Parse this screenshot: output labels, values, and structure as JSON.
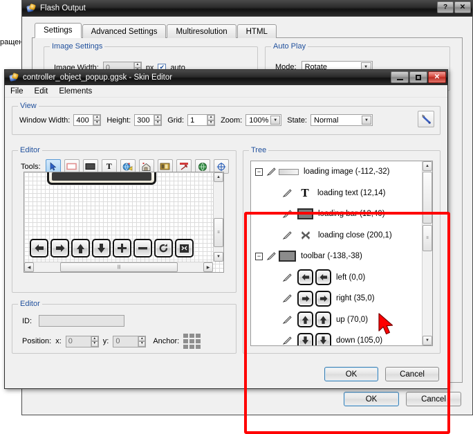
{
  "desktop": {
    "background_text": "ращени"
  },
  "flash_window": {
    "title": "Flash Output",
    "icon": "flash-app-icon",
    "help_button": "?",
    "close_button": "✕",
    "tabs": [
      {
        "label": "Settings",
        "active": true
      },
      {
        "label": "Advanced Settings",
        "active": false
      },
      {
        "label": "Multiresolution",
        "active": false
      },
      {
        "label": "HTML",
        "active": false
      }
    ],
    "image_settings": {
      "legend": "Image Settings",
      "width_label": "Image Width:",
      "width_value": "0",
      "unit_label": "px",
      "auto_checkbox": {
        "label": "auto",
        "checked": true
      }
    },
    "auto_play": {
      "legend": "Auto Play",
      "mode_label": "Mode:",
      "mode_value": "Rotate"
    },
    "ok_label": "OK",
    "cancel_label": "Cancel"
  },
  "skin_window": {
    "title": "controller_object_popup.ggsk - Skin Editor",
    "icon": "skin-editor-app-icon",
    "minimize_button": "—",
    "maximize_button": "❐",
    "close_button": "✕",
    "menu": [
      "File",
      "Edit",
      "Elements"
    ],
    "view": {
      "legend": "View",
      "window_width_label": "Window Width:",
      "window_width_value": "400",
      "height_label": "Height:",
      "height_value": "300",
      "grid_label": "Grid:",
      "grid_value": "1",
      "zoom_label": "Zoom:",
      "zoom_value": "100%",
      "state_label": "State:",
      "state_value": "Normal",
      "tools_button_icon": "wrench-screwdriver-icon"
    },
    "editor_tools": {
      "legend": "Editor",
      "tools_label": "Tools:",
      "tools": [
        {
          "name": "select-arrow-tool",
          "selected": true
        },
        {
          "name": "rectangle-tool",
          "selected": false
        },
        {
          "name": "filled-rectangle-tool",
          "selected": false
        },
        {
          "name": "text-tool",
          "selected": false
        },
        {
          "name": "add-image-tool",
          "selected": false
        },
        {
          "name": "add-hotspot-tool",
          "selected": false
        },
        {
          "name": "add-thumbnail-tool",
          "selected": false
        },
        {
          "name": "add-arrow-tool",
          "selected": false
        },
        {
          "name": "add-globe-tool",
          "selected": false
        },
        {
          "name": "add-target-tool",
          "selected": false
        }
      ]
    },
    "canvas": {
      "nav_buttons": [
        "left-arrow",
        "right-arrow",
        "up-arrow",
        "down-arrow",
        "plus",
        "minus",
        "rotate",
        "fullscreen"
      ],
      "scroll_thumb_glyph": "|||"
    },
    "editor_props": {
      "legend": "Editor",
      "id_label": "ID:",
      "id_value": "",
      "position_label": "Position:",
      "x_label": "x:",
      "x_value": "0",
      "y_label": "y:",
      "y_value": "0",
      "anchor_label": "Anchor:"
    },
    "tree": {
      "legend": "Tree",
      "items": [
        {
          "indent": 0,
          "expander": "−",
          "icon": "loading-image-icon",
          "label": "loading image (-112,-32)",
          "double_icon": false
        },
        {
          "indent": 1,
          "expander": "",
          "icon": "text-T-icon",
          "label": "loading text (12,14)",
          "double_icon": false
        },
        {
          "indent": 1,
          "expander": "",
          "icon": "loading-bar-icon",
          "label": "loading bar (12,40)",
          "double_icon": false
        },
        {
          "indent": 1,
          "expander": "",
          "icon": "close-x-icon",
          "label": "loading close (200,1)",
          "double_icon": false
        },
        {
          "indent": 0,
          "expander": "−",
          "icon": "toolbar-icon",
          "label": "toolbar (-138,-38)",
          "double_icon": false
        },
        {
          "indent": 1,
          "expander": "",
          "icon": "left-arrow-icon",
          "label": "left (0,0)",
          "double_icon": true
        },
        {
          "indent": 1,
          "expander": "",
          "icon": "right-arrow-icon",
          "label": "right (35,0)",
          "double_icon": true
        },
        {
          "indent": 1,
          "expander": "",
          "icon": "up-arrow-icon",
          "label": "up (70,0)",
          "double_icon": true
        },
        {
          "indent": 1,
          "expander": "",
          "icon": "down-arrow-icon",
          "label": "down (105,0)",
          "double_icon": true
        }
      ]
    },
    "ok_label": "OK",
    "cancel_label": "Cancel"
  },
  "colors": {
    "highlight": "#ff0000",
    "group_legend": "#1f4f9c",
    "cursor": "#ff0000",
    "selected_tool": "#a9d2f3"
  }
}
